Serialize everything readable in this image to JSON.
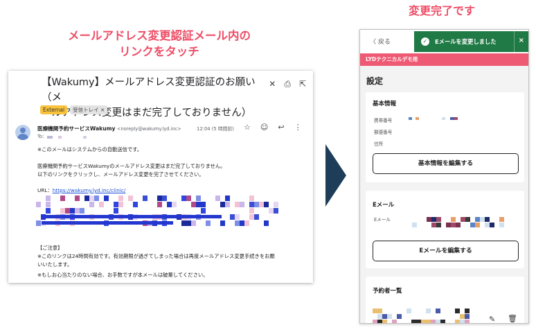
{
  "captions": {
    "left_line1": "メールアドレス変更認証メール内の",
    "left_line2": "リンクをタッチ",
    "right": "変更完了です"
  },
  "email": {
    "subject_line1": "【Wakumy】メールアドレス変更認証のお願い（メ",
    "subject_line2": "ールアドレス変更はまだ完了しておりません）",
    "tags": [
      "External",
      "受信トレイ ×"
    ],
    "sender_name": "医療機関予約サービスWakumy",
    "sender_address": "<noreply@wakumy.lyd.inc>",
    "to_label": "To:",
    "time": "12:04 (5 時間前)",
    "body_lines": [
      "※このメールはシステムからの自動送信です。",
      "医療機関予約サービスWakumyのメールアドレス変更はまだ完了しておりません。",
      "以下のリンクをクリックし、メールアドレス変更を完了させてください。"
    ],
    "url_label": "URL：",
    "url": "https://wakumy.lyd.inc/clinic/",
    "notice_lines": [
      "【ご注意】",
      "※このリンクは24時間有効です。有効期限が過ぎてしまった場合は再度メールアドレス変更手続きをお願",
      "いいたします。",
      "※もしお心当たりのない場合、お手数ですが本メールは破棄してください。"
    ]
  },
  "phone": {
    "back_label": "〈 戻る",
    "toast_message": "Eメールを変更しました",
    "toast_close": "×",
    "banner": "LYDテクニカルデモ用",
    "title": "設定",
    "basic_info": {
      "title": "基本情報",
      "labels": [
        "携帯番号",
        "郵便番号",
        "住所"
      ],
      "edit_button": "基本情報を編集する"
    },
    "email_section": {
      "title": "Eメール",
      "label": "Eメール",
      "edit_button": "Eメールを編集する"
    },
    "reservers": {
      "title": "予約者一覧"
    }
  },
  "colors": {
    "caption": "#ee4d66",
    "toast": "#1f7a45",
    "banner": "#ee5a73",
    "link": "#1a4fd6",
    "arrow": "#1e3d59"
  }
}
